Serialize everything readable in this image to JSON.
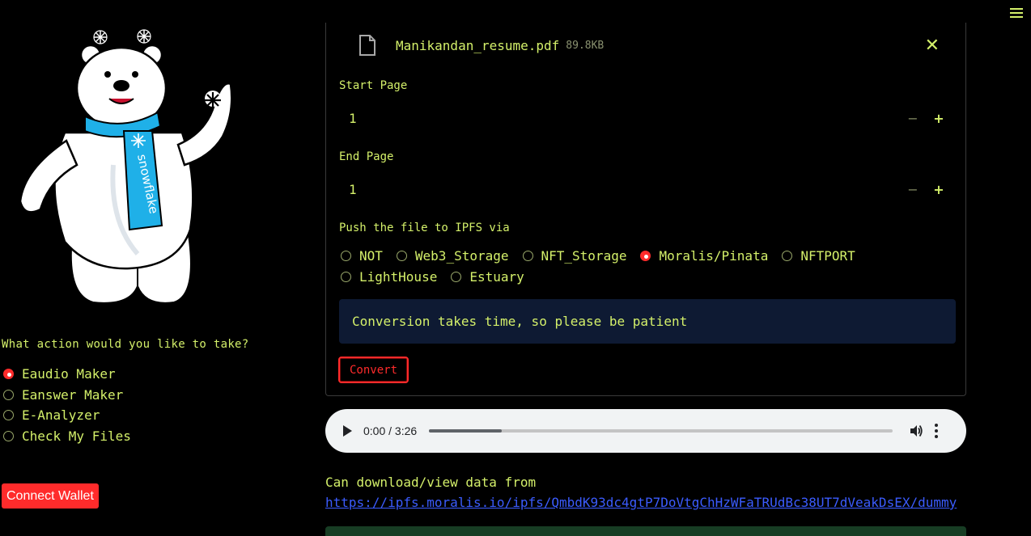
{
  "sidebar": {
    "action_prompt": "What action would you like to take?",
    "actions": [
      {
        "label": "Eaudio Maker",
        "selected": true
      },
      {
        "label": "Eanswer Maker",
        "selected": false
      },
      {
        "label": "E-Analyzer",
        "selected": false
      },
      {
        "label": "Check My Files",
        "selected": false
      }
    ],
    "connect_wallet_label": "Connect Wallet",
    "mascot": {
      "icon": "polar-bear-mascot-icon",
      "scarf_text": "snowflake"
    }
  },
  "file": {
    "name": "Manikandan_resume.pdf",
    "size": "89.8KB",
    "close_icon": "close-icon"
  },
  "start_page": {
    "label": "Start Page",
    "value": "1",
    "minus": "−",
    "plus": "+"
  },
  "end_page": {
    "label": "End Page",
    "value": "1",
    "minus": "−",
    "plus": "+"
  },
  "ipfs": {
    "label": "Push the file to IPFS via",
    "options": [
      {
        "label": "NOT",
        "selected": false
      },
      {
        "label": "Web3_Storage",
        "selected": false
      },
      {
        "label": "NFT_Storage",
        "selected": false
      },
      {
        "label": "Moralis/Pinata",
        "selected": true
      },
      {
        "label": "NFTPORT",
        "selected": false
      },
      {
        "label": "LightHouse",
        "selected": false
      },
      {
        "label": "Estuary",
        "selected": false
      }
    ]
  },
  "info_message": "Conversion takes time, so please be patient",
  "convert_label": "Convert",
  "audio": {
    "time": "0:00 / 3:26",
    "progress": 0.157
  },
  "download": {
    "text": "Can download/view data from",
    "link": "https://ipfs.moralis.io/ipfs/QmbdK93dc4gtP7DoVtgChHzWFaTRUdBc38UT7dVeakDsEX/dummy"
  },
  "colors": {
    "accent": "#d4f06a",
    "primary": "#ff2b2b",
    "info_bg": "#0e1a33",
    "link": "#3b5cff",
    "background": "#000000"
  }
}
